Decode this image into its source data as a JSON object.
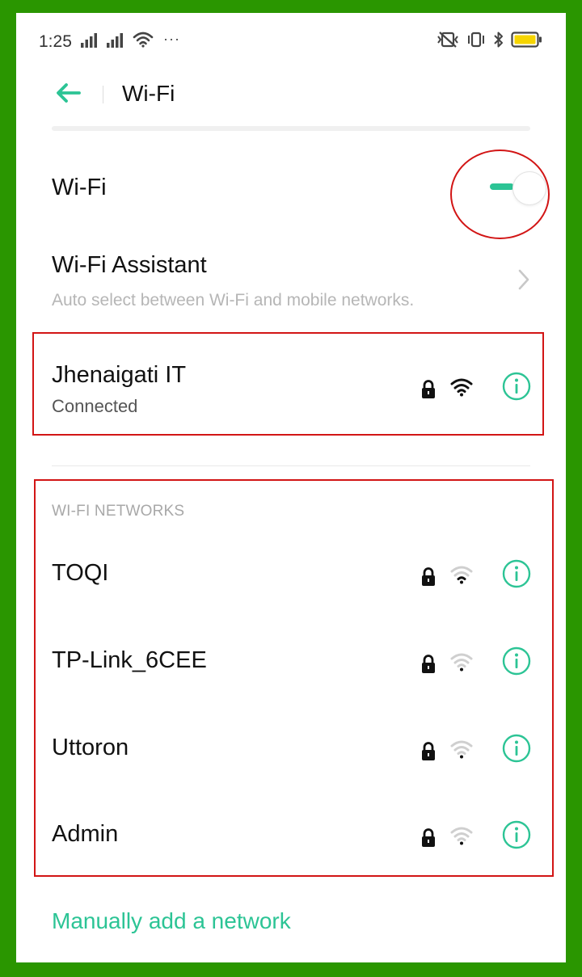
{
  "status_bar": {
    "time": "1:25",
    "more": "···",
    "battery_color": "#f6d500"
  },
  "header": {
    "title": "Wi-Fi",
    "accent": "#2cc495"
  },
  "wifi_toggle": {
    "label": "Wi-Fi",
    "state": "on"
  },
  "assistant": {
    "title": "Wi-Fi Assistant",
    "subtitle": "Auto select between Wi-Fi and mobile networks."
  },
  "connected": {
    "name": "Jhenaigati IT",
    "status": "Connected"
  },
  "networks": {
    "heading": "WI-FI NETWORKS",
    "items": [
      {
        "name": "TOQI"
      },
      {
        "name": "TP-Link_6CEE"
      },
      {
        "name": "Uttoron"
      },
      {
        "name": "Admin"
      }
    ]
  },
  "manual_add": "Manually add a network"
}
